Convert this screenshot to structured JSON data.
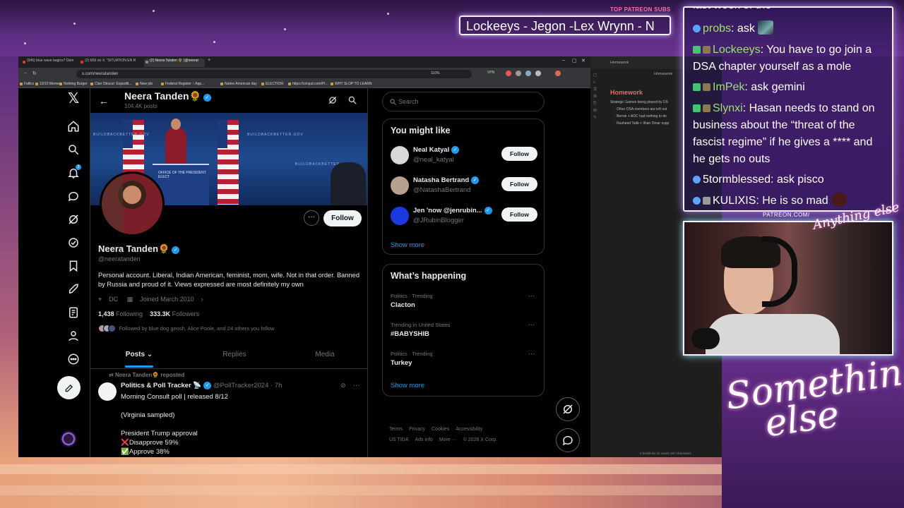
{
  "overlay": {
    "top_patreon_label": "TOP PATREON SUBS",
    "patreon_names": "Lockeeys - Jegon -Lex Wrynn - N",
    "patreon_url": "PATREON.COM/",
    "signature_small": "Anything else",
    "signature_big_line1": "Something",
    "signature_big_line2": "else"
  },
  "browser": {
    "tabs": [
      "(945) blue wave begins? Dem",
      "(2) MSI on X: \"SITUATION EN R",
      "(2) Neera Tanden 🌻 (@neerat",
      "+"
    ],
    "url": "x.com/neeratanden",
    "zoom": "110%",
    "vpn": "VPN",
    "bookmarks": [
      "Fallics",
      "10/10 Memes",
      "Nothing Burger",
      "Clair Obscur: Expediti...",
      "New job",
      "Federal Register :: App...",
      "Native American day",
      "ELECTION",
      "https://cimput.com/Pr...",
      "WHY SLOP TO LEARN"
    ],
    "window_controls": [
      "–",
      "▢",
      "✕"
    ]
  },
  "x": {
    "nav_icons": [
      "x-logo-icon",
      "home-icon",
      "search-icon",
      "bell-icon",
      "messages-icon",
      "grok-icon",
      "verified-icon",
      "bookmark-icon",
      "rocket-icon",
      "draft-icon",
      "profile-icon",
      "more-icon"
    ],
    "notification_count": "2",
    "profile": {
      "name": "Neera Tanden🌻",
      "posts_count": "104.4K posts",
      "handle": "@neeratanden",
      "bio": "Personal account. Liberal, Indian American, feminist, mom, wife. Not in that order. Banned by Russia and proud of it. Views expressed are most definitely my own",
      "location": "DC",
      "joined": "Joined March 2010",
      "following_count": "1,438",
      "following_label": "Following",
      "followers_count": "333.3K",
      "followers_label": "Followers",
      "followed_by": "Followed by blue dog geosh, Alice Poole, and 24 others you follow",
      "follow_label": "Follow",
      "more_label": "···"
    },
    "banner_text": [
      "BUILDBACKBETTER.GOV",
      "OFFICE OF THE PRESIDENT ELECT"
    ],
    "tabs": [
      "Posts",
      "Replies",
      "Media"
    ],
    "tweet": {
      "reposted_by": "Neera Tanden🌻 reposted",
      "author": "Politics & Poll Tracker 📡",
      "handle_time": "@PollTracker2024 · 7h",
      "body": "Morning Consult poll | released 8/12\n\n(Virginia sampled)\n\nPresident Trump approval\n❌Disapprove 59%\n✅Approve 38%"
    },
    "search_placeholder": "Search",
    "you_might_like": {
      "title": "You might like",
      "items": [
        {
          "name": "Neal Katyal",
          "handle": "@neal_katyal",
          "follow": "Follow"
        },
        {
          "name": "Natasha Bertrand",
          "handle": "@NatashaBertrand",
          "follow": "Follow"
        },
        {
          "name": "Jen 'now @jenrubin...",
          "handle": "@JRubinBlogger",
          "follow": "Follow"
        }
      ],
      "show_more": "Show more"
    },
    "whats_happening": {
      "title": "What’s happening",
      "items": [
        {
          "context": "Politics · Trending",
          "name": "Clacton"
        },
        {
          "context": "Trending in United States",
          "name": "#BABYSHIB"
        },
        {
          "context": "Politics · Trending",
          "name": "Turkey"
        }
      ],
      "show_more": "Show more",
      "dots": "···"
    },
    "footer": [
      "Terms",
      "Privacy",
      "Cookies",
      "Accessibility",
      "US TIDA",
      "Ads info",
      "More ···",
      "© 2026 X Corp."
    ]
  },
  "notes": {
    "tab": "Homework",
    "title_small": "Homework",
    "heading": "Homework",
    "lines": [
      "Strategic Games being played by DS",
      "· Other DSA members are left out",
      "· Bernie + AOC had nothing to do",
      "· Rasheed Talib + Ilhan Omar supp"
    ],
    "status": "0 backlinks    31 words    167 characters"
  },
  "chat": {
    "top_partial": "last week of the",
    "messages": [
      {
        "user": "probs",
        "text": ": ask",
        "user_white": false
      },
      {
        "user": "Lockeeys",
        "text": ": You have to go join a DSA chapter yourself as a mole",
        "user_white": false
      },
      {
        "user": "ImPek",
        "text": ": ask gemini",
        "user_white": false
      },
      {
        "user": "Slynxi",
        "text": ": Hasan needs to stand on business about the “threat of the fascist regime” if he gives a **** and he gets no outs",
        "user_white": false
      },
      {
        "user": "5tormblessed",
        "text": ": ask pisco",
        "user_white": true
      },
      {
        "user": "KULIXIS",
        "text": ": He is so mad",
        "user_white": true
      }
    ]
  },
  "colors": {
    "accent": "#1d9bf0",
    "chat_user": "#9ce26a",
    "notes_heading": "#e56b6b"
  }
}
